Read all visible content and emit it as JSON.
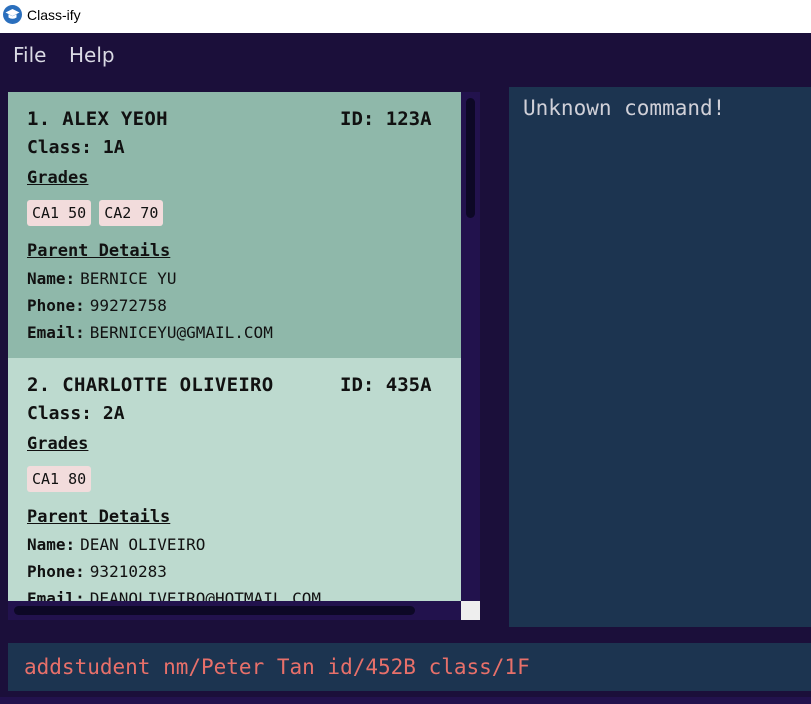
{
  "window": {
    "title": "Class-ify",
    "icon": "graduation-cap-icon"
  },
  "menu": {
    "items": [
      "File",
      "Help"
    ]
  },
  "students": [
    {
      "index": "1.",
      "name": "ALEX YEOH",
      "id_label": "ID:",
      "id": "123A",
      "class_label": "Class:",
      "class": "1A",
      "grades_heading": "Grades",
      "grades": [
        "CA1 50",
        "CA2 70"
      ],
      "parent_heading": "Parent Details",
      "parent_name_label": "Name:",
      "parent_name": "BERNICE YU",
      "phone_label": "Phone:",
      "phone": "99272758",
      "email_label": "Email:",
      "email": "BERNICEYU@GMAIL.COM"
    },
    {
      "index": "2.",
      "name": "CHARLOTTE OLIVEIRO",
      "id_label": "ID:",
      "id": "435A",
      "class_label": "Class:",
      "class": "2A",
      "grades_heading": "Grades",
      "grades": [
        "CA1 80"
      ],
      "parent_heading": "Parent Details",
      "parent_name_label": "Name:",
      "parent_name": "DEAN OLIVEIRO",
      "phone_label": "Phone:",
      "phone": "93210283",
      "email_label": "Email:",
      "email": "DEANOLIVEIRO@HOTMAIL.COM"
    }
  ],
  "result": {
    "message": "Unknown command!"
  },
  "command": {
    "value": "addstudent nm/Peter Tan id/452B class/1F"
  },
  "colors": {
    "background": "#1b0f3a",
    "selected_card": "#8fb8aa",
    "card": "#bddacf",
    "grade_tag": "#f2dcdc",
    "result_panel": "#1c3450",
    "command_text": "#e8706a"
  }
}
